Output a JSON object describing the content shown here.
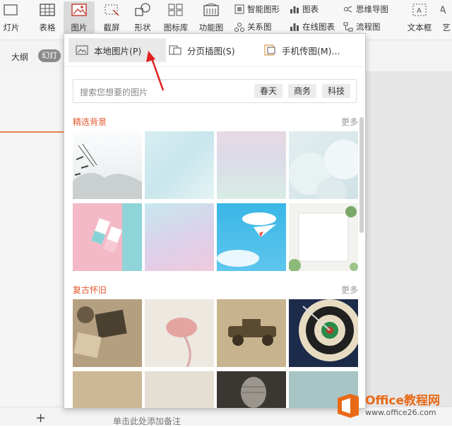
{
  "ribbon": {
    "items": [
      {
        "label": "灯片",
        "icon": "slide-icon"
      },
      {
        "label": "表格",
        "icon": "table-icon"
      },
      {
        "label": "图片",
        "icon": "picture-icon"
      },
      {
        "label": "截屏",
        "icon": "screenshot-icon"
      },
      {
        "label": "形状",
        "icon": "shapes-icon"
      },
      {
        "label": "图标库",
        "icon": "icon-library-icon"
      },
      {
        "label": "功能图",
        "icon": "function-chart-icon"
      },
      {
        "label": "文本框",
        "icon": "textbox-icon"
      },
      {
        "label": "艺",
        "icon": "art-text-icon"
      }
    ],
    "small": {
      "smart_graphic": "智能图形",
      "chart": "图表",
      "mind_map": "思维导图",
      "relation_map": "关系图",
      "online_chart": "在线图表",
      "flowchart": "流程图"
    }
  },
  "bar2": {
    "outline": "大纲",
    "slide": "幻灯"
  },
  "panel": {
    "tabs": [
      {
        "label": "本地图片(P)",
        "icon": "local-picture-icon"
      },
      {
        "label": "分页插图(S)",
        "icon": "page-insert-icon"
      },
      {
        "label": "手机传图(M)...",
        "icon": "phone-transfer-icon"
      }
    ],
    "search": {
      "placeholder": "搜索您想要的图片",
      "tags": [
        "春天",
        "商务",
        "科技"
      ]
    },
    "sections": [
      {
        "title": "精选背景",
        "more": "更多"
      },
      {
        "title": "复古怀旧",
        "more": "更多"
      }
    ]
  },
  "editor": {
    "plus": "+",
    "note_hint": "单击此处添加备注"
  },
  "watermark": {
    "brand": "Office教程网",
    "url": "www.office26.com"
  },
  "colors": {
    "accent": "#e4572e",
    "watermark_orange": "#e86a17"
  }
}
